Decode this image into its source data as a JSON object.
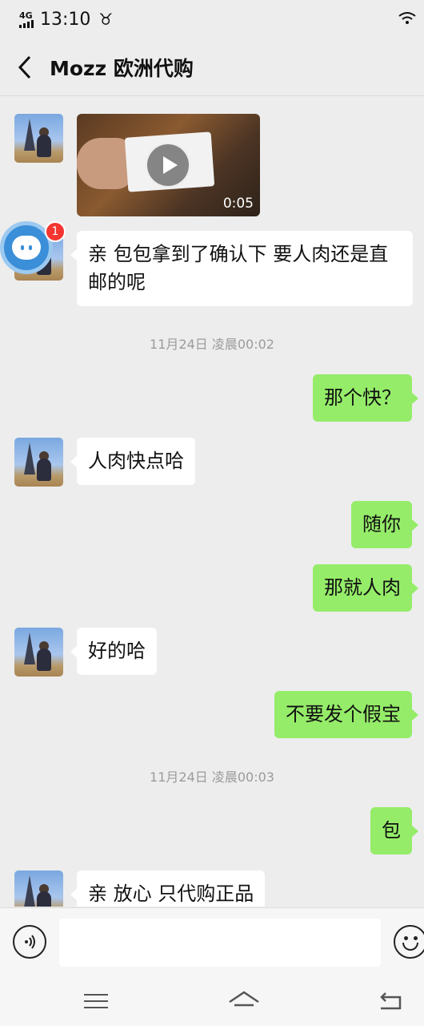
{
  "status_bar": {
    "network": "4G",
    "time": "13:10"
  },
  "header": {
    "title": "Mozz 欧洲代购"
  },
  "video_message": {
    "duration": "0:05"
  },
  "assistant_badge": {
    "count": "1"
  },
  "messages": [
    {
      "side": "in",
      "text": "亲 包包拿到了确认下 要人肉还是直邮的呢"
    },
    {
      "side": "out",
      "text": "那个快？"
    },
    {
      "side": "in",
      "text": "人肉快点哈"
    },
    {
      "side": "out",
      "text": "随你"
    },
    {
      "side": "out",
      "text": "那就人肉"
    },
    {
      "side": "in",
      "text": "好的哈"
    },
    {
      "side": "out",
      "text": "不要发个假宝"
    },
    {
      "side": "out",
      "text": "包"
    },
    {
      "side": "in",
      "text": "亲 放心 只代购正品"
    }
  ],
  "timestamps": [
    "11月24日 凌晨00:02",
    "11月24日 凌晨00:03"
  ],
  "input": {
    "placeholder": ""
  },
  "icons": {
    "back": "back-arrow-icon",
    "voice": "voice-icon",
    "emoji": "emoji-icon",
    "menu": "menu-icon",
    "home": "home-icon",
    "nav_back": "nav-back-icon",
    "play": "play-icon",
    "wifi": "wifi-icon"
  },
  "colors": {
    "outgoing_bubble": "#95ec69",
    "incoming_bubble": "#ffffff",
    "background": "#ededed",
    "badge": "#f43530"
  }
}
